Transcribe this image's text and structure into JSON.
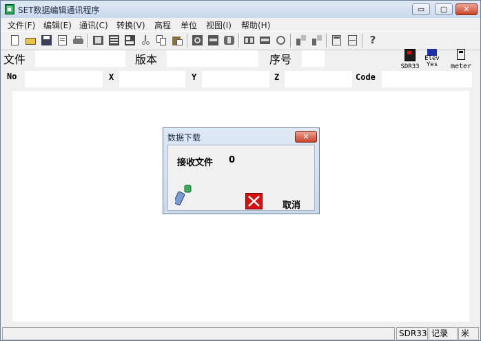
{
  "window": {
    "title": "SET数据编辑通讯程序",
    "app_icon": "app-icon",
    "controls": {
      "minimize": "▭",
      "maximize": "▢",
      "close": "✕"
    }
  },
  "menu": {
    "items": [
      {
        "label": "文件(F)"
      },
      {
        "label": "编辑(E)"
      },
      {
        "label": "通讯(C)"
      },
      {
        "label": "转换(V)"
      },
      {
        "label": "高程"
      },
      {
        "label": "单位"
      },
      {
        "label": "视图(I)"
      },
      {
        "label": "帮助(H)"
      }
    ]
  },
  "toolbar": {
    "icons": [
      "new-file-icon",
      "open-file-icon",
      "save-icon",
      "preview-icon",
      "print-icon",
      "find-icon",
      "edit-icon",
      "data-icon",
      "cut-icon",
      "copy-icon",
      "paste-icon",
      "convert-icon",
      "convert-edit-icon",
      "export-icon",
      "layout-icon",
      "layout-edit-icon",
      "layout-export-icon",
      "elevation-icon",
      "elevation-edit-icon",
      "calculator-icon",
      "calculator-edit-icon",
      "help-icon"
    ]
  },
  "file_info": {
    "file_label": "文件",
    "version_label": "版本",
    "sequence_label": "序号"
  },
  "instrument_status": {
    "model": "SDR33",
    "elev_line1": "Elev",
    "elev_line2": "Yes",
    "unit": "meter"
  },
  "columns": {
    "no": "No",
    "x": "X",
    "y": "Y",
    "z": "Z",
    "code": "Code"
  },
  "statusbar": {
    "model": "SDR33",
    "mode": "记录",
    "unit": "米"
  },
  "dialog": {
    "title": "数据下载",
    "close": "✕",
    "receive_label": "接收文件",
    "receive_count": "0",
    "cancel_label": "取消"
  }
}
